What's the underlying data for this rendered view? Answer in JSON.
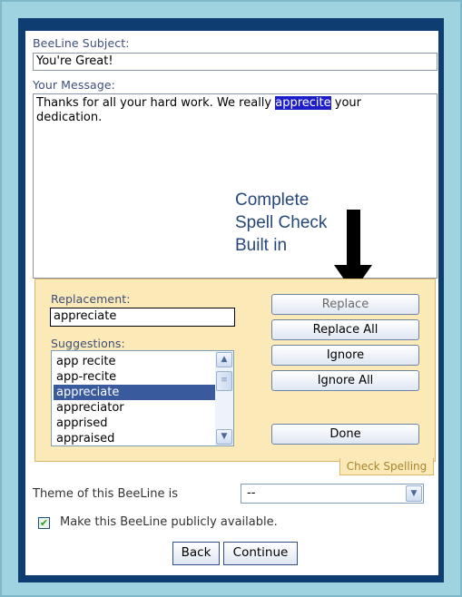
{
  "form": {
    "subject_label": "BeeLine Subject:",
    "subject_value": "You're Great!",
    "message_label": "Your Message:",
    "message_text_before": "Thanks for all your hard work. We really ",
    "message_misspelled": "apprecite",
    "message_text_line1_after": " your",
    "message_text_line2": "dedication."
  },
  "callout": {
    "line1": "Complete",
    "line2": "Spell Check",
    "line3": "Built in"
  },
  "spell_check": {
    "replacement_label": "Replacement:",
    "replacement_value": "appreciate",
    "suggestions_label": "Suggestions:",
    "suggestions": [
      "app recite",
      "app-recite",
      "appreciate",
      "appreciator",
      "apprised",
      "appraised"
    ],
    "selected_suggestion": "appreciate",
    "replace_label": "Replace",
    "replace_all_label": "Replace All",
    "ignore_label": "Ignore",
    "ignore_all_label": "Ignore All",
    "done_label": "Done",
    "tab_label": "Check Spelling"
  },
  "theme": {
    "label": "Theme of this BeeLine is",
    "selected": "--"
  },
  "public": {
    "label": "Make this BeeLine publicly available.",
    "checked": true
  },
  "nav": {
    "back_label": "Back",
    "continue_label": "Continue"
  },
  "colors": {
    "frame": "#0e3d72",
    "outer_border": "#9fd3df",
    "spell_panel": "#fbe9b7",
    "highlight": "#1e1ec8",
    "selected_item": "#3a5a9e"
  }
}
